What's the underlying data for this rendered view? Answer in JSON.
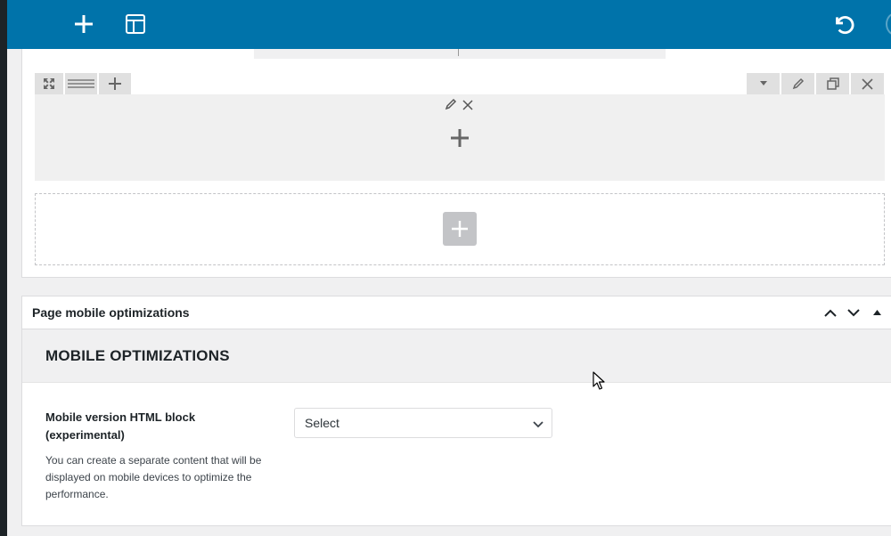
{
  "toolbar": {
    "add_icon": "plus-icon",
    "layout_icon": "layout-icon",
    "undo_icon": "undo-icon"
  },
  "builder": {
    "row_tools_left": [
      "expand-icon",
      "drag-handle-icon",
      "plus-icon"
    ],
    "row_tools_right": [
      "chevron-down-icon",
      "pencil-icon",
      "duplicate-icon",
      "close-icon"
    ],
    "column_tools": [
      "pencil-icon",
      "close-icon"
    ],
    "column_add_icon": "plus-icon",
    "add_row_icon": "plus-icon"
  },
  "metabox": {
    "title": "Page mobile optimizations",
    "actions": [
      "chevron-up-icon",
      "chevron-down-icon",
      "triangle-up-icon"
    ],
    "section_title": "MOBILE OPTIMIZATIONS",
    "field": {
      "label": "Mobile version HTML block (experimental)",
      "description": "You can create a separate content that will be displayed on mobile devices to optimize the performance.",
      "select_value": "Select"
    }
  },
  "colors": {
    "topbar": "#0073aa",
    "panel_bg": "#f0f0f1",
    "tool_bg": "#e0e0e0"
  }
}
